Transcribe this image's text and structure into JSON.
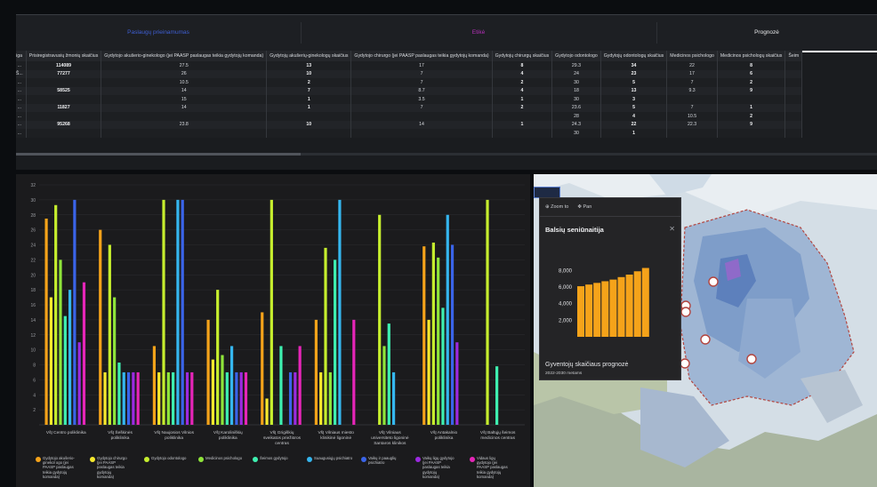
{
  "tabs": [
    {
      "label": "Paslaugų prieinamumas",
      "color": "#3f5fd4"
    },
    {
      "label": "Etikė",
      "color": "#b32fb7"
    },
    {
      "label": "Prognozė",
      "color": "#e9eaec"
    }
  ],
  "table": {
    "headers": [
      "Įstaiga",
      "Prisiregistravusių žmonių skaičius",
      "Gydytojo akušerio-ginekologo (jei PAASP paslaugas teikia gydytojų komanda)",
      "Gydytojų akušerių-ginekologų skaičius",
      "Gydytojo chirurgo (jei PAASP paslaugas teikia gydytojų komanda)",
      "Gydytojų chirurgų skaičius",
      "Gydytojo odontologo",
      "Gydytojų odontologų skaičius",
      "Medicinos psichologo",
      "Medicinos psichologų skaičius",
      "Šeim"
    ],
    "rows": [
      [
        "VšĮ ...",
        "114089",
        "27.5",
        "13",
        "17",
        "8",
        "29.3",
        "34",
        "22",
        "8",
        ""
      ],
      [
        "VšĮ Š...",
        "77277",
        "26",
        "10",
        "7",
        "4",
        "24",
        "23",
        "17",
        "6",
        ""
      ],
      [
        "VšĮ ...",
        "",
        "10.5",
        "2",
        "7",
        "2",
        "30",
        "5",
        "7",
        "2",
        ""
      ],
      [
        "VšĮ ...",
        "58525",
        "14",
        "7",
        "8.7",
        "4",
        "18",
        "13",
        "9.3",
        "9",
        ""
      ],
      [
        "VšĮ ...",
        "",
        "15",
        "1",
        "3.5",
        "1",
        "30",
        "3",
        "",
        "",
        ""
      ],
      [
        "VšĮ ...",
        "11827",
        "14",
        "1",
        "7",
        "2",
        "23.6",
        "5",
        "7",
        "1",
        ""
      ],
      [
        "VšĮ ...",
        "",
        "",
        "",
        "",
        "",
        "28",
        "4",
        "10.5",
        "2",
        ""
      ],
      [
        "VšĮ ...",
        "95268",
        "23.8",
        "10",
        "14",
        "1",
        "24.3",
        "22",
        "22.3",
        "9",
        ""
      ],
      [
        "VšĮ ...",
        "",
        "",
        "",
        "",
        "",
        "30",
        "1",
        "",
        "",
        ""
      ]
    ]
  },
  "chart_data": {
    "type": "bar",
    "ylim": [
      0,
      32
    ],
    "yticks": [
      2,
      4,
      6,
      8,
      10,
      12,
      14,
      16,
      18,
      20,
      22,
      24,
      26,
      28,
      30,
      32
    ],
    "categories": [
      "VšĮ Centro poliklinika",
      "VšĮ Šeškinės poliklinika",
      "VšĮ Naujosios Vilnios poliklinika",
      "VšĮ Karoliniškių poliklinika",
      "VšĮ Grigiškių sveikatos priežiūros centras",
      "VšĮ Vilniaus miesto klinikinė ligoninė",
      "VšĮ Vilniaus universiteto ligoninė Santaros klinikos",
      "VšĮ Antakalnio poliklinika",
      "VšĮ Baltųjų šeimos medicinos centras"
    ],
    "series": [
      {
        "name": "Gydytojo akušerio-ginekologo (jei PAASP paslaugas teikia gydytojų komanda)",
        "color": "#f5a31a",
        "values": [
          27.5,
          26,
          10.5,
          14,
          15,
          14,
          null,
          23.8,
          null
        ]
      },
      {
        "name": "Gydytojo chirurgo (jei PAASP paslaugas teikia gydytojų komanda)",
        "color": "#f7ea2d",
        "values": [
          17,
          7,
          7,
          8.7,
          3.5,
          7,
          null,
          14,
          null
        ]
      },
      {
        "name": "Gydytojo odontologo",
        "color": "#c6ee2e",
        "values": [
          29.3,
          24,
          30,
          18,
          30,
          23.6,
          28,
          24.3,
          30
        ]
      },
      {
        "name": "Medicinos psichologo",
        "color": "#8fe53a",
        "values": [
          22,
          17,
          7,
          9.3,
          null,
          7,
          10.5,
          22.3,
          null
        ]
      },
      {
        "name": "Šeimos gydytojo",
        "color": "#3ef0b0",
        "values": [
          14.5,
          8.3,
          7,
          7,
          10.5,
          22,
          13.5,
          15.6,
          7.8
        ]
      },
      {
        "name": "Suaugusiųjų psichiatro",
        "color": "#35b6ef",
        "values": [
          18,
          7,
          30,
          10.5,
          null,
          30,
          7,
          28,
          null
        ]
      },
      {
        "name": "Vaikų ir paauglių psichiatro",
        "color": "#3a64e9",
        "values": [
          30,
          7,
          30,
          7,
          7,
          null,
          null,
          24,
          null
        ]
      },
      {
        "name": "Vaikų ligų gydytojo (jei PAASP paslaugas teikia gydytojų komanda)",
        "color": "#9c2ae1",
        "values": [
          11,
          7,
          7,
          7,
          7,
          null,
          null,
          11,
          null
        ]
      },
      {
        "name": "Vidaus ligų gydytojo (jei PAASP paslaugas teikia gydytojų komanda)",
        "color": "#e625b8",
        "values": [
          19,
          7,
          7,
          7,
          10.5,
          14,
          null,
          null,
          null
        ]
      }
    ]
  },
  "legend": [
    {
      "label": "Gydytojo akušerio-ginekol ogo (jei PAASP paslaugas teikia gydytojų komanda)",
      "color": "#f5a31a"
    },
    {
      "label": "Gydytojo chirurgo (jei PAASP paslaugas teikia gydytojų komanda)",
      "color": "#f7ea2d"
    },
    {
      "label": "Gydytojo odontologo",
      "color": "#c6ee2e"
    },
    {
      "label": "Medicinos psichologo",
      "color": "#8fe53a"
    },
    {
      "label": "Šeimos gydytojo",
      "color": "#3ef0b0"
    },
    {
      "label": "Suaugusiųjų psichiatro",
      "color": "#35b6ef"
    },
    {
      "label": "Vaikų ir paauglių psichiatro",
      "color": "#3a64e9"
    },
    {
      "label": "Vaikų ligų gydytojo (jei PAASP paslaugas teikia gydytojų komanda)",
      "color": "#9c2ae1"
    },
    {
      "label": "Vidaus ligų gydytojo (jei PAASP paslaugas teikia gydytojų komanda)",
      "color": "#e625b8"
    }
  ],
  "popup": {
    "zoom_label": "Zoom to",
    "pan_label": "Pan",
    "title": "Balsių seniūnaitija",
    "footer_title": "Gyventojų skaičiaus prognozė",
    "footer_sub": "2022-2030 metams",
    "yticks": [
      "8,000",
      "6,000",
      "4,000",
      "2,000"
    ],
    "bar_color": "#f5a31a",
    "values": [
      6100,
      6300,
      6500,
      6700,
      6900,
      7200,
      7500,
      7900,
      8300
    ]
  }
}
